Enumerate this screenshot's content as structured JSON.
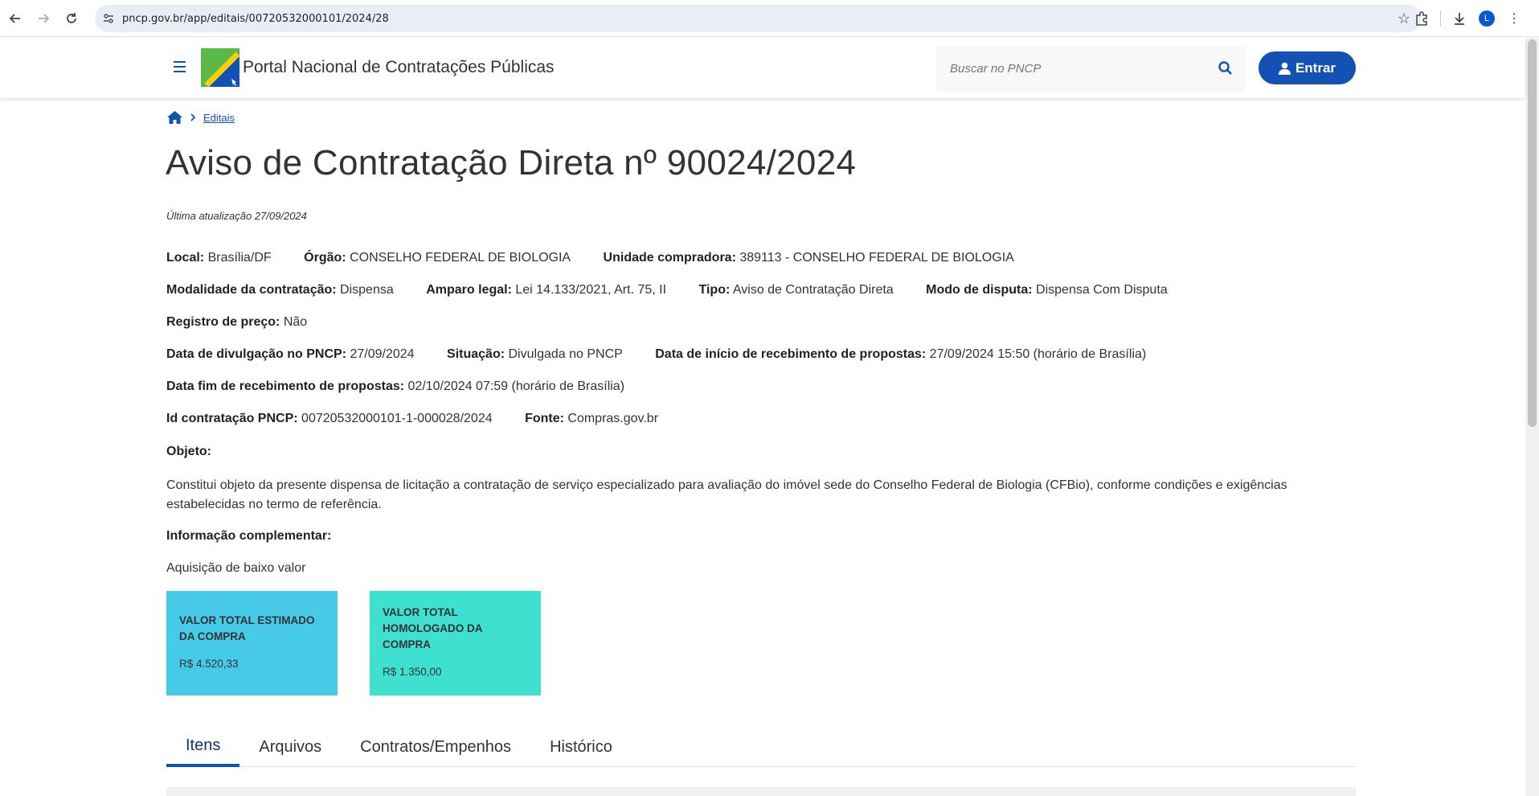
{
  "browser": {
    "url": "pncp.gov.br/app/editais/00720532000101/2024/28",
    "avatar_letter": "L"
  },
  "header": {
    "portal_title": "Portal Nacional de Contratações Públicas",
    "search_placeholder": "Buscar no PNCP",
    "login_label": "Entrar"
  },
  "breadcrumb": {
    "items": [
      "Editais"
    ]
  },
  "page": {
    "title": "Aviso de Contratação Direta nº 90024/2024",
    "last_update": "Última atualização 27/09/2024"
  },
  "fields": {
    "local": {
      "label": "Local:",
      "value": "Brasília/DF"
    },
    "orgao": {
      "label": "Órgão:",
      "value": "CONSELHO FEDERAL DE BIOLOGIA"
    },
    "unidade": {
      "label": "Unidade compradora:",
      "value": "389113 - CONSELHO FEDERAL DE BIOLOGIA"
    },
    "modalidade": {
      "label": "Modalidade da contratação:",
      "value": "Dispensa"
    },
    "amparo": {
      "label": "Amparo legal:",
      "value": "Lei 14.133/2021, Art. 75, II"
    },
    "tipo": {
      "label": "Tipo:",
      "value": "Aviso de Contratação Direta"
    },
    "modo": {
      "label": "Modo de disputa:",
      "value": "Dispensa Com Disputa"
    },
    "registro": {
      "label": "Registro de preço:",
      "value": "Não"
    },
    "divulgacao": {
      "label": "Data de divulgação no PNCP:",
      "value": "27/09/2024"
    },
    "situacao": {
      "label": "Situação:",
      "value": "Divulgada no PNCP"
    },
    "inicio": {
      "label": "Data de início de recebimento de propostas:",
      "value": "27/09/2024 15:50 (horário de Brasília)"
    },
    "fim": {
      "label": "Data fim de recebimento de propostas:",
      "value": "02/10/2024 07:59 (horário de Brasília)"
    },
    "id": {
      "label": "Id contratação PNCP:",
      "value": "00720532000101-1-000028/2024"
    },
    "fonte": {
      "label": "Fonte:",
      "value": "Compras.gov.br"
    }
  },
  "objeto": {
    "label": "Objeto:",
    "text": "Constitui objeto da presente dispensa de licitação a contratação de serviço especializado para avaliação do imóvel sede do Conselho Federal de Biologia (CFBio), conforme condições e exigências estabelecidas no termo de referência."
  },
  "info_complementar": {
    "label": "Informação complementar:",
    "text": "Aquisição de baixo valor"
  },
  "cards": {
    "estimado": {
      "title": "VALOR TOTAL ESTIMADO DA COMPRA",
      "value": "R$ 4.520,33",
      "color": "#47c9e8"
    },
    "homologado": {
      "title": "VALOR TOTAL HOMOLOGADO DA COMPRA",
      "value": "R$ 1.350,00",
      "color": "#3ee0cf"
    }
  },
  "tabs": [
    {
      "label": "Itens"
    },
    {
      "label": "Arquivos"
    },
    {
      "label": "Contratos/Empenhos"
    },
    {
      "label": "Histórico"
    }
  ],
  "colors": {
    "brand_blue": "#1351b4",
    "tab_active": "#0c326f"
  }
}
